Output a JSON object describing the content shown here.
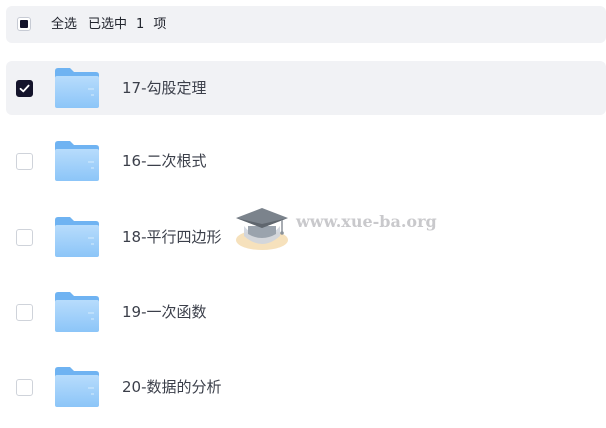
{
  "header": {
    "select_all_label": "全选",
    "selected_prefix": "已选中",
    "selected_count": "1",
    "selected_suffix": "项",
    "select_all_state": "partial"
  },
  "files": [
    {
      "name": "17-勾股定理",
      "checked": true
    },
    {
      "name": "16-二次根式",
      "checked": false
    },
    {
      "name": "18-平行四边形",
      "checked": false
    },
    {
      "name": "19-一次函数",
      "checked": false
    },
    {
      "name": "20-数据的分析",
      "checked": false
    }
  ],
  "icons": {
    "folder": "folder-icon",
    "check": "checkmark-icon",
    "watermark_logo": "graduation-cap-logo"
  },
  "watermark": {
    "text": "www.xue-ba.org"
  },
  "colors": {
    "selected_row_bg": "#f1f2f5",
    "check_fill": "#14142b",
    "folder_light": "#a8d4fb",
    "folder_dark": "#6fb3f2"
  }
}
